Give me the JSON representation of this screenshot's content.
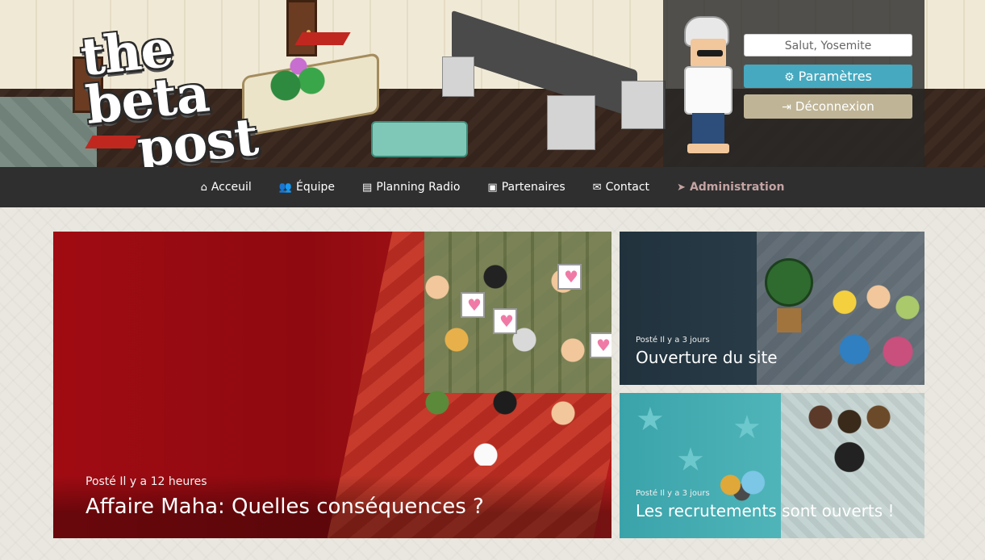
{
  "header": {
    "logo_line1": "the beta",
    "logo_line2": "post",
    "greeting": "Salut, Yosemite",
    "settings_label": "Paramètres",
    "logout_label": "Déconnexion",
    "settings_icon": "gear-icon",
    "logout_icon": "sign-out-icon"
  },
  "nav": {
    "items": [
      {
        "label": "Acceuil",
        "icon": "home-icon"
      },
      {
        "label": "Équipe",
        "icon": "users-icon"
      },
      {
        "label": "Planning Radio",
        "icon": "list-icon"
      },
      {
        "label": "Partenaires",
        "icon": "briefcase-icon"
      },
      {
        "label": "Contact",
        "icon": "envelope-icon"
      },
      {
        "label": "Administration",
        "icon": "paper-plane-icon"
      }
    ]
  },
  "articles": {
    "main": {
      "posted": "Posté Il y a 12 heures",
      "title": "Affaire Maha: Quelles conséquences ?"
    },
    "side1": {
      "posted": "Posté Il y a 3 jours",
      "title": "Ouverture du site"
    },
    "side2": {
      "posted": "Posté Il y a 3 jours",
      "title": "Les recrutements sont ouverts !"
    }
  },
  "colors": {
    "nav_bg": "#2f2f2f",
    "settings_btn": "#46a9bf",
    "logout_btn": "#bfb596",
    "admin_link": "#c4a3a3",
    "main_card": "#9e0d12"
  }
}
